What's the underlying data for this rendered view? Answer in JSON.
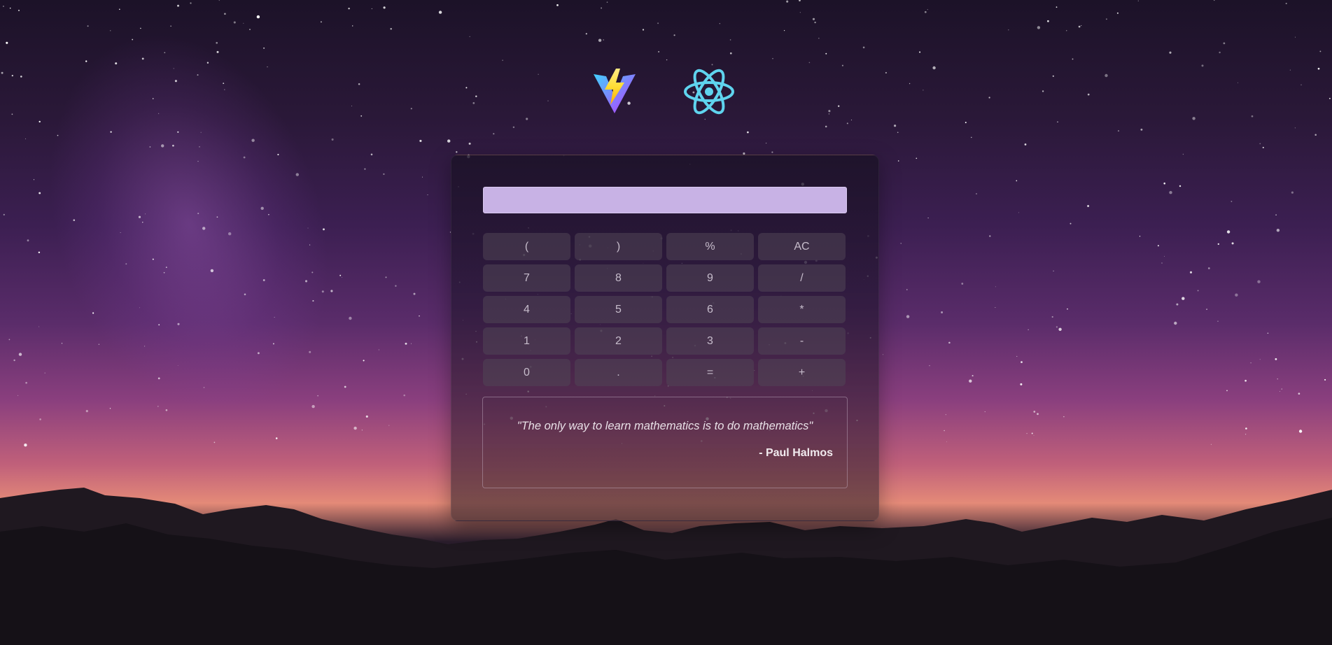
{
  "logos": [
    "vite-logo",
    "react-logo"
  ],
  "calculator": {
    "display_value": "",
    "keys": [
      "(",
      ")",
      "%",
      "AC",
      "7",
      "8",
      "9",
      "/",
      "4",
      "5",
      "6",
      "*",
      "1",
      "2",
      "3",
      "-",
      "0",
      ".",
      "=",
      "+"
    ]
  },
  "quote": {
    "text": "\"The only way to learn mathematics is to do mathematics\"",
    "author": "- Paul Halmos"
  },
  "colors": {
    "display": "#c8b2e5",
    "react": "#5fd4ee"
  }
}
